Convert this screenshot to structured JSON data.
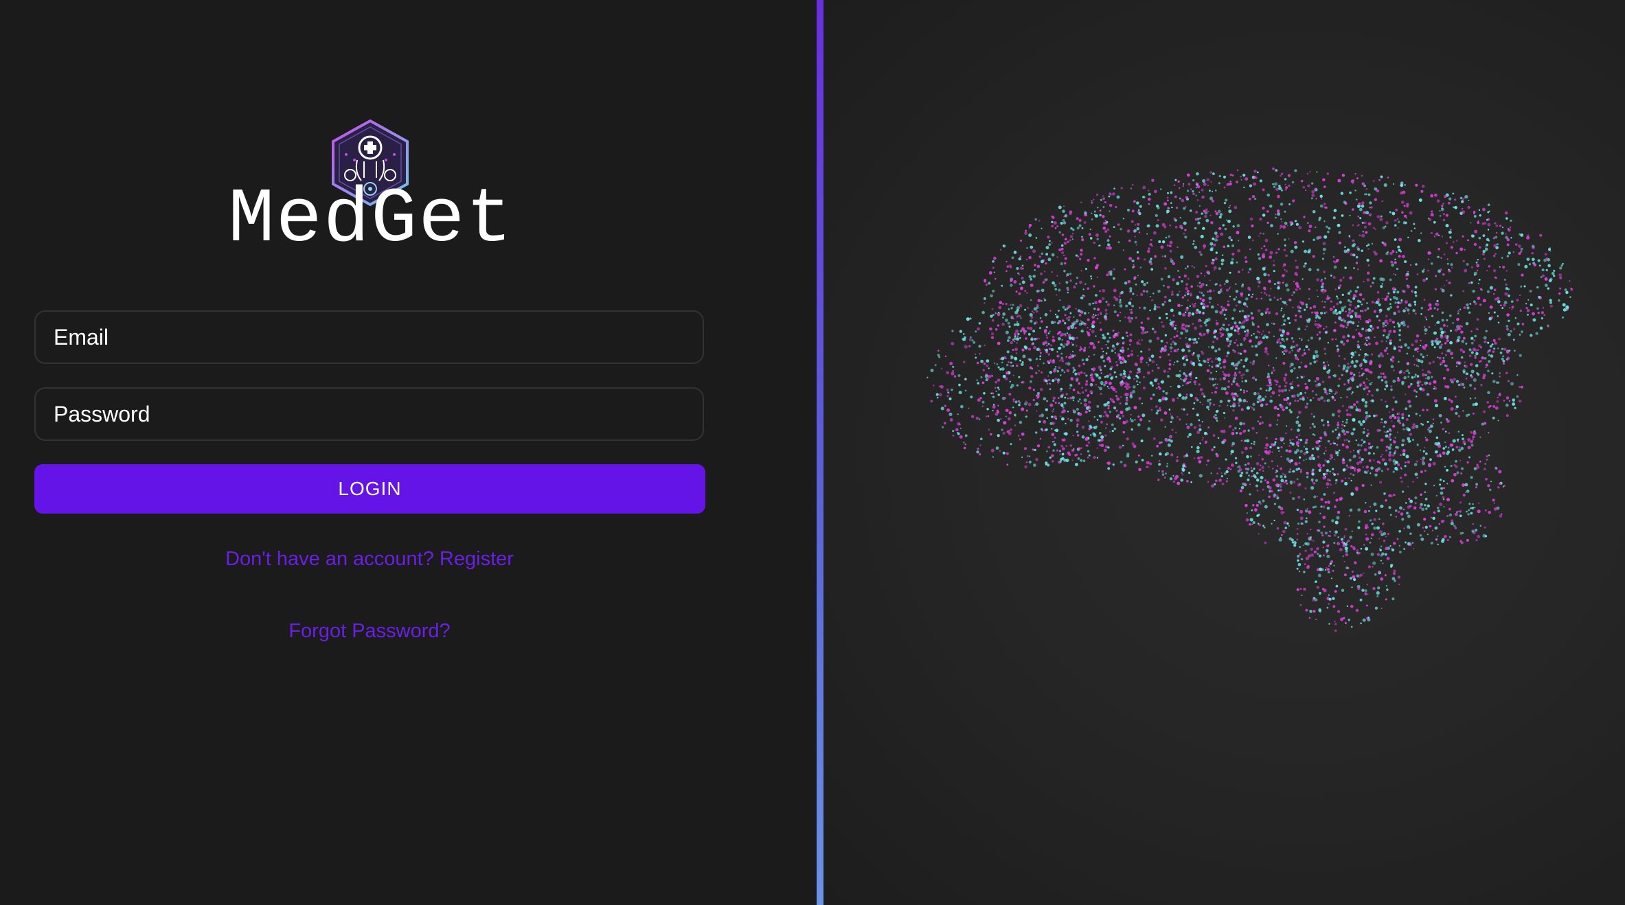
{
  "brand": {
    "name": "MedGet",
    "logo_icon": "medical-hexagon-logo"
  },
  "form": {
    "email_placeholder": "Email",
    "email_value": "",
    "password_placeholder": "Password",
    "password_value": "",
    "login_label": "LOGIN",
    "register_link": "Don't have an account? Register",
    "forgot_link": "Forgot Password?"
  },
  "illustration": {
    "icon": "particle-brain-illustration"
  },
  "colors": {
    "background": "#1b1b1b",
    "accent": "#6414e6",
    "link": "#6a1fe6",
    "brain_magenta": "#e03ee0",
    "brain_cyan": "#6fe3e3",
    "divider_top": "#6a2fe0",
    "divider_bottom": "#6a93e6"
  }
}
